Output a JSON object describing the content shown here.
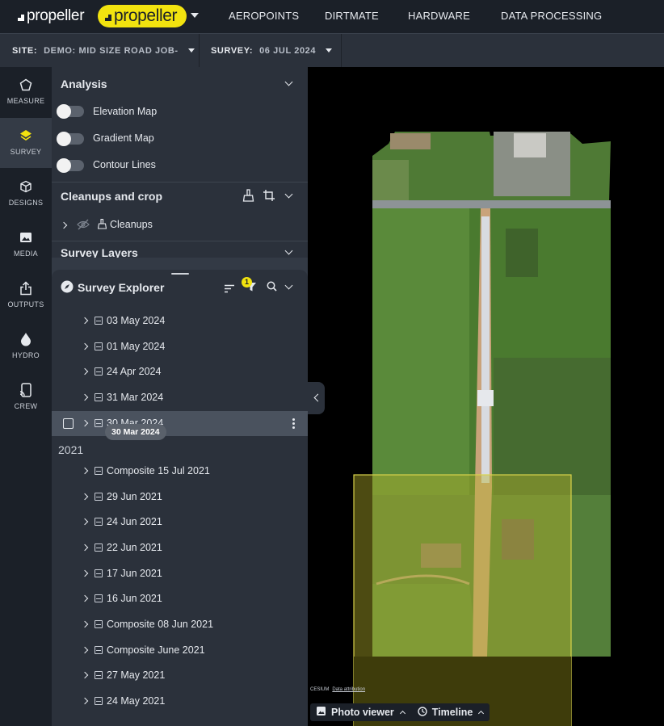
{
  "brand": {
    "logo_text": "propeller",
    "logo_pill_text": "propeller"
  },
  "nav": {
    "links": [
      "AEROPOINTS",
      "DIRTMATE",
      "HARDWARE",
      "DATA PROCESSING"
    ]
  },
  "sitebar": {
    "site_label": "SITE:",
    "site_value": "DEMO: MID SIZE ROAD JOB-",
    "survey_label": "SURVEY:",
    "survey_value": "06 JUL 2024"
  },
  "rail": {
    "items": [
      {
        "label": "MEASURE",
        "icon": "pentagon-icon"
      },
      {
        "label": "SURVEY",
        "icon": "layers-icon",
        "active": true
      },
      {
        "label": "DESIGNS",
        "icon": "cube-icon"
      },
      {
        "label": "MEDIA",
        "icon": "image-icon"
      },
      {
        "label": "OUTPUTS",
        "icon": "share-icon"
      },
      {
        "label": "HYDRO",
        "icon": "drop-icon"
      },
      {
        "label": "CREW",
        "icon": "device-icon"
      }
    ]
  },
  "analysis": {
    "title": "Analysis",
    "toggles": [
      "Elevation Map",
      "Gradient Map",
      "Contour Lines"
    ]
  },
  "cleanups": {
    "title": "Cleanups and crop",
    "item_label": "Cleanups"
  },
  "survey_layers": {
    "title": "Survey Layers"
  },
  "explorer": {
    "title": "Survey Explorer",
    "filter_badge": "1",
    "surveys_top": [
      "03 May 2024",
      "01 May 2024",
      "24 Apr 2024",
      "31 Mar 2024"
    ],
    "selected_survey": "30 Mar 2024",
    "tooltip": "30 Mar 2024",
    "year_header": "2021",
    "surveys_2021": [
      "Composite 15 Jul 2021",
      "29 Jun 2021",
      "24 Jun 2021",
      "22 Jun 2021",
      "17 Jun 2021",
      "16 Jun 2021",
      "Composite 08 Jun 2021",
      "Composite June 2021",
      "27 May 2021",
      "24 May 2021"
    ]
  },
  "map": {
    "attribution_brand": "CESIUM",
    "attribution_link": "Data attribution"
  },
  "bottom": {
    "photo_viewer": "Photo viewer",
    "timeline": "Timeline"
  },
  "colors": {
    "accent": "#f2e30f",
    "nav_bg": "#1b2028",
    "panel_bg": "#2b313b"
  }
}
